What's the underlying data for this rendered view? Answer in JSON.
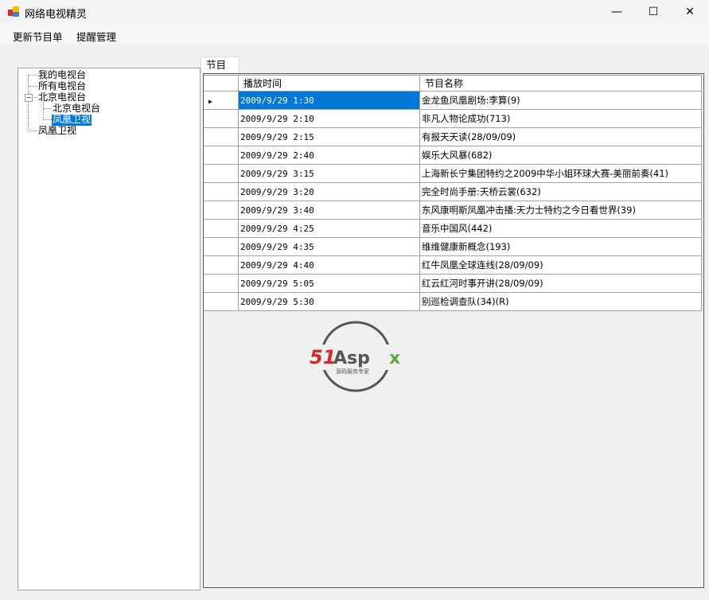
{
  "window": {
    "title": "网络电视精灵",
    "minimize": "—",
    "maximize": "☐",
    "close": "✕"
  },
  "menu": [
    "更新节目单",
    "提醒管理"
  ],
  "tree": {
    "nodes": [
      "我的电视台",
      "所有电视台",
      "北京电视台",
      "北京电视台",
      "凤凰卫视",
      "凤凰卫视"
    ],
    "expander": "−"
  },
  "tab": "节目",
  "grid": {
    "columns": [
      "播放时间",
      "节目名称"
    ],
    "rows": [
      [
        "2009/9/29 1:30",
        "金龙鱼凤凰剧场:李算(9)"
      ],
      [
        "2009/9/29 2:10",
        "非凡人物论成功(713)"
      ],
      [
        "2009/9/29 2:15",
        "有报天天读(28/09/09)"
      ],
      [
        "2009/9/29 2:40",
        "娱乐大风暴(682)"
      ],
      [
        "2009/9/29 3:15",
        "上海新长宁集团特约之2009中华小姐环球大赛-美丽前奏(41)"
      ],
      [
        "2009/9/29 3:20",
        "完全时尚手册:天桥云裳(632)"
      ],
      [
        "2009/9/29 3:40",
        "东风康明斯凤凰冲击播:天力士特约之今日看世界(39)"
      ],
      [
        "2009/9/29 4:25",
        "音乐中国风(442)"
      ],
      [
        "2009/9/29 4:35",
        "维维健康新概念(193)"
      ],
      [
        "2009/9/29 4:40",
        "红牛凤凰全球连线(28/09/09)"
      ],
      [
        "2009/9/29 5:05",
        "红云红河时事开讲(28/09/09)"
      ],
      [
        "2009/9/29 5:30",
        "别巡检调查队(34)(R)"
      ]
    ],
    "current_row_marker": "▶"
  },
  "watermark": {
    "brand": "51Aspx",
    "tagline": "源码服务专家"
  }
}
